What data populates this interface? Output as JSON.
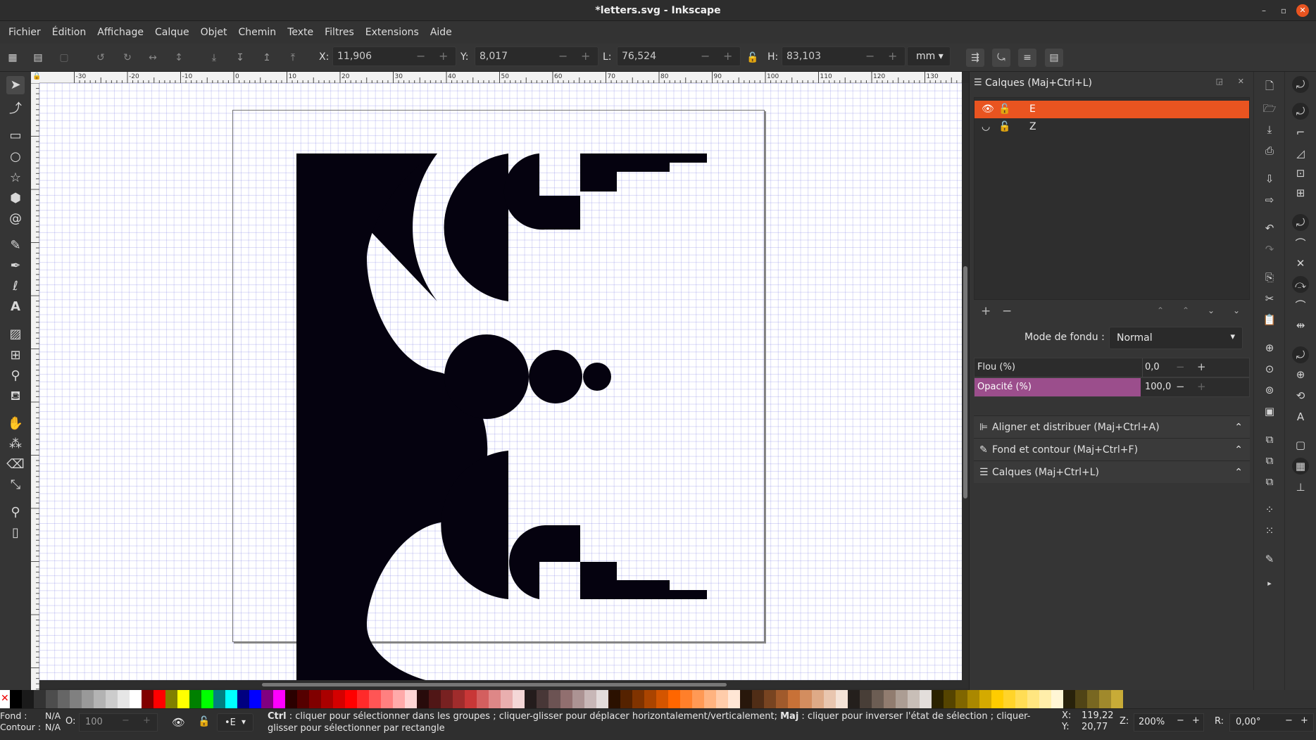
{
  "window": {
    "title": "*letters.svg - Inkscape"
  },
  "menu": [
    "Fichier",
    "Édition",
    "Affichage",
    "Calque",
    "Objet",
    "Chemin",
    "Texte",
    "Filtres",
    "Extensions",
    "Aide"
  ],
  "toolbar": {
    "x_label": "X:",
    "x_value": "11,906",
    "y_label": "Y:",
    "y_value": "8,017",
    "w_label": "L:",
    "w_value": "76,524",
    "h_label": "H:",
    "h_value": "83,103",
    "unit": "mm"
  },
  "ruler_top_labels": [
    "-30",
    "-20",
    "-10",
    "0",
    "10",
    "20",
    "30",
    "40",
    "50",
    "60",
    "70",
    "80",
    "90",
    "100",
    "110",
    "120",
    "130"
  ],
  "panel": {
    "title": "Calques (Maj+Ctrl+L)",
    "layers": [
      {
        "name": "E",
        "selected": true
      },
      {
        "name": "Z",
        "selected": false
      }
    ],
    "blend_label": "Mode de fondu :",
    "blend_value": "Normal",
    "blur_label": "Flou (%)",
    "blur_value": "0,0",
    "opacity_label": "Opacité (%)",
    "opacity_value": "100,0",
    "opacity_level": 100,
    "sections": [
      "Aligner et distribuer (Maj+Ctrl+A)",
      "Fond et contour (Maj+Ctrl+F)",
      "Calques (Maj+Ctrl+L)"
    ]
  },
  "status": {
    "fill_label": "Fond :",
    "fill_value": "N/A",
    "stroke_label": "Contour :",
    "stroke_value": "N/A",
    "opacity_label": "O:",
    "opacity_value": "100",
    "layer_value": "•E",
    "message_bold1": "Ctrl",
    "message_part1": " : cliquer pour sélectionner dans les groupes ; cliquer-glisser pour déplacer horizontalement/verticalement; ",
    "message_bold2": "Maj",
    "message_part2": " : cliquer pour inverser l'état de sélection ; cliquer-glisser pour sélectionner par rectangle",
    "cursor_x_label": "X:",
    "cursor_x": "119,22",
    "cursor_y_label": "Y:",
    "cursor_y": "20,77",
    "zoom_label": "Z:",
    "zoom_value": "200%",
    "rotate_label": "R:",
    "rotate_value": "0,00°"
  },
  "colors": {
    "accent": "#e95420",
    "opacity_bar": "#9b4e8c",
    "artwork": "#05020f",
    "palette": [
      "#000000",
      "#1a1a1a",
      "#333333",
      "#4d4d4d",
      "#666666",
      "#808080",
      "#999999",
      "#b3b3b3",
      "#cccccc",
      "#e6e6e6",
      "#ffffff",
      "#800000",
      "#ff0000",
      "#808000",
      "#ffff00",
      "#008000",
      "#00ff00",
      "#008080",
      "#00ffff",
      "#000080",
      "#0000ff",
      "#800080",
      "#ff00ff",
      "#2b0000",
      "#550000",
      "#800000",
      "#aa0000",
      "#d40000",
      "#ff0000",
      "#ff2a2a",
      "#ff5555",
      "#ff8080",
      "#ffaaaa",
      "#ffd5d5",
      "#280b0b",
      "#501616",
      "#782121",
      "#a02c2c",
      "#c83737",
      "#d35f5f",
      "#de8787",
      "#e9afaf",
      "#f4d7d7",
      "#241c1c",
      "#483737",
      "#6c5353",
      "#916f6f",
      "#ac9393",
      "#c8b7b7",
      "#e3dbdb",
      "#2b1100",
      "#552200",
      "#803300",
      "#aa4400",
      "#d45500",
      "#ff6600",
      "#ff7f2a",
      "#ff9955",
      "#ffb380",
      "#ffccaa",
      "#ffe6d5",
      "#28170b",
      "#502d16",
      "#784421",
      "#a05a2c",
      "#c87137",
      "#d38d5f",
      "#deaa87",
      "#e9c6af",
      "#f4e3d7",
      "#241f1c",
      "#483e37",
      "#6c5d53",
      "#917c6f",
      "#ac9d93",
      "#c8beb7",
      "#e3dedb",
      "#2b2200",
      "#554400",
      "#806600",
      "#aa8800",
      "#d4aa00",
      "#ffcc00",
      "#ffd42a",
      "#ffdd55",
      "#ffe680",
      "#ffeeaa",
      "#fff6d5",
      "#28220b",
      "#504416",
      "#786721",
      "#a0892c",
      "#c8ab37"
    ]
  }
}
